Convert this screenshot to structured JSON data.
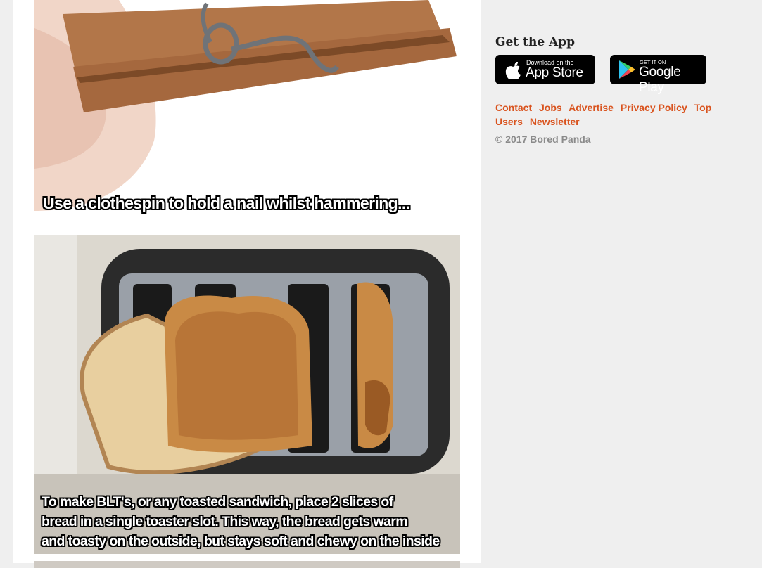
{
  "feed": {
    "posts": [
      {
        "caption": "Use a clothespin to hold a nail whilst hammering..."
      },
      {
        "caption_lines": [
          "To make BLT's, or any toasted sandwich, place 2 slices of",
          "bread in a single toaster slot. This way, the bread gets warm",
          "and toasty on the outside, but stays soft and chewy on the inside"
        ]
      }
    ]
  },
  "sidebar": {
    "get_app_title": "Get the App",
    "app_store": {
      "small": "Download on the",
      "big": "App Store"
    },
    "google_play": {
      "small": "GET IT ON",
      "big": "Google Play"
    },
    "footer_links": [
      "Contact",
      "Jobs",
      "Advertise",
      "Privacy Policy",
      "Top Users",
      "Newsletter"
    ],
    "copyright": "© 2017 Bored Panda"
  },
  "colors": {
    "link": "#d9531e",
    "page_bg": "#efefef"
  }
}
